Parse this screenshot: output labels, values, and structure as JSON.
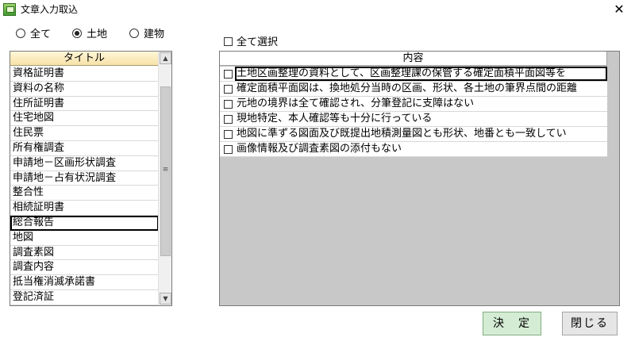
{
  "window": {
    "title": "文章入力取込",
    "close_glyph": "✕"
  },
  "filter": {
    "options": [
      {
        "label": "全て",
        "selected": false
      },
      {
        "label": "土地",
        "selected": true
      },
      {
        "label": "建物",
        "selected": false
      }
    ]
  },
  "select_all": {
    "label": "全て選択",
    "checked": false
  },
  "title_list": {
    "header": "タイトル",
    "items": [
      "資格証明書",
      "資料の名称",
      "住所証明書",
      "住宅地図",
      "住民票",
      "所有権調査",
      "申請地－区画形状調査",
      "申請地－占有状況調査",
      "整合性",
      "相続証明書",
      "総合報告",
      "地図",
      "調査素図",
      "調査内容",
      "抵当権消滅承諾書",
      "登記済証"
    ],
    "selected_index": 10
  },
  "content_list": {
    "header": "内容",
    "items": [
      "土地区画整理の資料として、区画整理課の保管する確定面積平面図等を",
      "確定面積平面図は、換地処分当時の区画、形状、各土地の筆界点間の距離",
      "元地の境界は全て確認され、分筆登記に支障はない",
      "現地特定、本人確認等も十分に行っている",
      "地図に準ずる図面及び既提出地積測量図とも形状、地番とも一致してい",
      "画像情報及び調査素図の添付もない"
    ],
    "active_index": 0
  },
  "buttons": {
    "ok": "決　定",
    "close": "閉じる"
  },
  "icons": {
    "scroll_up": "▲",
    "scroll_down": "▼",
    "thumb_grip": "≡"
  }
}
